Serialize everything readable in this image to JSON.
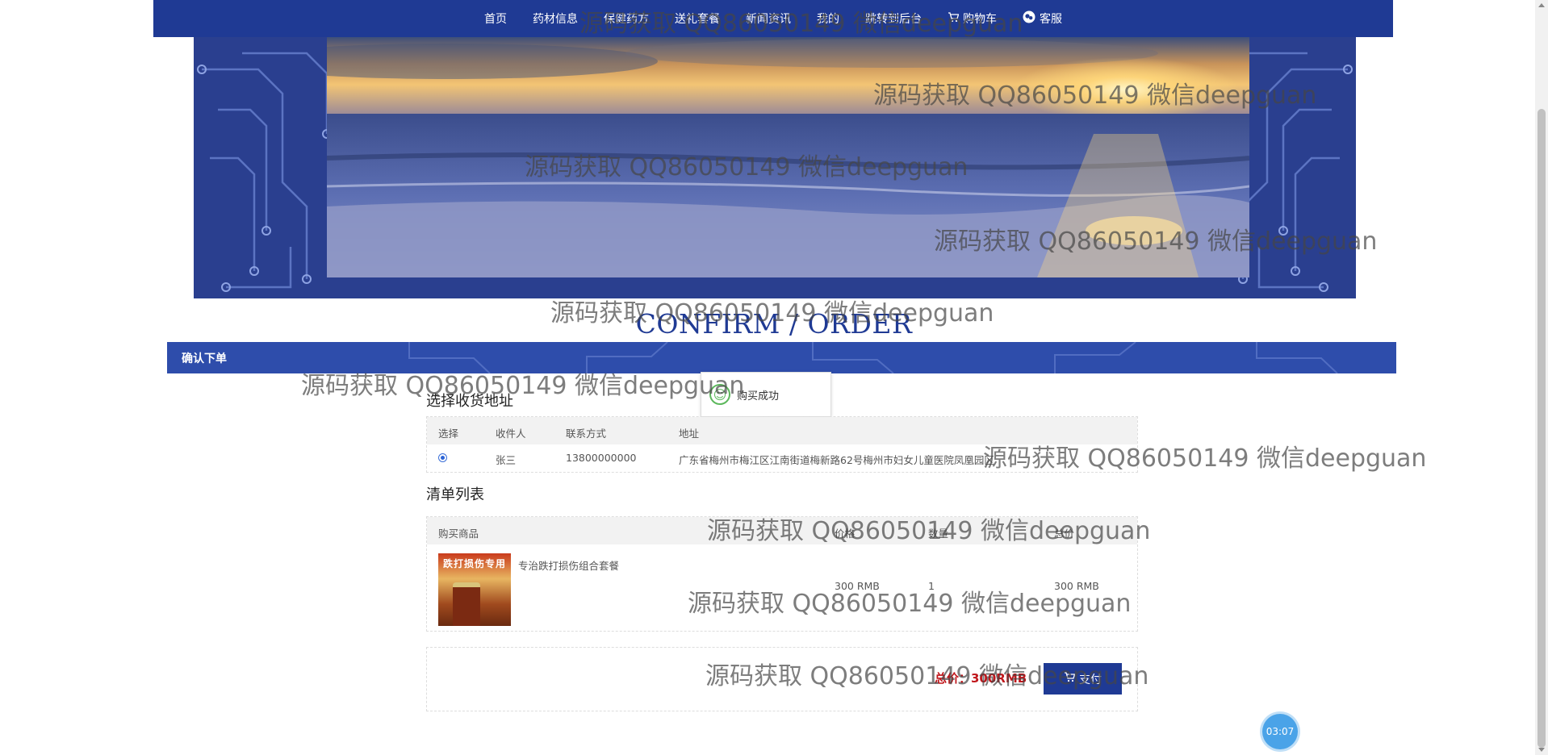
{
  "nav": {
    "items": [
      {
        "label": "首页",
        "icon": ""
      },
      {
        "label": "药材信息",
        "icon": ""
      },
      {
        "label": "保健药方",
        "icon": ""
      },
      {
        "label": "送礼套餐",
        "icon": ""
      },
      {
        "label": "新闻资讯",
        "icon": ""
      },
      {
        "label": "我的",
        "icon": ""
      },
      {
        "label": "跳转到后台",
        "icon": ""
      },
      {
        "label": "购物车",
        "icon": "cart-icon"
      },
      {
        "label": "客服",
        "icon": "chat-icon"
      }
    ]
  },
  "page": {
    "title": "CONFIRM / ORDER",
    "section_label": "确认下单"
  },
  "toast": {
    "message": "购买成功"
  },
  "address": {
    "title": "选择收货地址",
    "headers": [
      "选择",
      "收件人",
      "联系方式",
      "地址"
    ],
    "rows": [
      {
        "selected": true,
        "recipient": "张三",
        "phone": "13800000000",
        "address": "广东省梅州市梅江区江南街道梅新路62号梅州市妇女儿童医院凤凰园区"
      }
    ]
  },
  "cart": {
    "title": "清单列表",
    "headers": [
      "购买商品",
      "价格",
      "数量",
      "总价"
    ],
    "items": [
      {
        "name": "专治跌打损伤组合套餐",
        "image_text": "跌打损伤专用",
        "price": "300 RMB",
        "quantity": "1",
        "total": "300 RMB"
      }
    ]
  },
  "summary": {
    "total_label": "总价：300RMB",
    "pay_label": "支付"
  },
  "timer": "03:07",
  "watermarks": [
    "源码获取 QQ86050149 微信deepguan",
    "源码获取 QQ86050149 微信deepguan",
    "源码获取 QQ86050149 微信deepguan",
    "源码获取 QQ86050149 微信deepguan",
    "源码获取 QQ86050149 微信deepguan",
    "源码获取 QQ86050149 微信deepguan",
    "源码获取 QQ86050149 微信deepguan",
    "源码获取 QQ86050149 微信deepguan",
    "源码获取 QQ86050149 微信deepguan",
    "源码获取 QQ86050149 微信deepguan",
    "源码获取 QQ86050149 微信deepguan"
  ],
  "colors": {
    "brand_blue": "#1f3a94",
    "price_red": "#c0161b",
    "timer_blue": "#4aa3e8"
  }
}
